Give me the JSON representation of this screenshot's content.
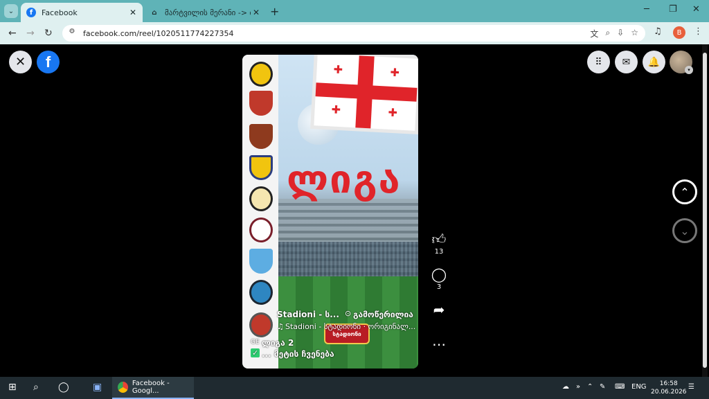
{
  "browser": {
    "tabs": [
      {
        "title": "Facebook",
        "favicon": "facebook-icon",
        "active": true
      },
      {
        "title": "მარტვილის მერანი -> თბი",
        "favicon": "bookmark-icon",
        "active": false
      }
    ],
    "address": "facebook.com/reel/1020511774227354",
    "profile_initial": "B"
  },
  "reel": {
    "title_text": "ლიგა",
    "author": "Stadioni - ს...",
    "follow_label": "გამოწერილია",
    "audio": "Stadioni - სტადიონი · ორიგინალ...",
    "stadium_logo": "სტადიონი",
    "caption_line1": "ლიგა 2",
    "caption_flag": "GE",
    "caption_line2": "... მეტის ჩვენება",
    "likes": "13",
    "comments": "3"
  },
  "taskbar": {
    "chrome_label": "Facebook - Googl...",
    "lang": "ENG",
    "time": "16:58",
    "date": "20.06.2026"
  }
}
